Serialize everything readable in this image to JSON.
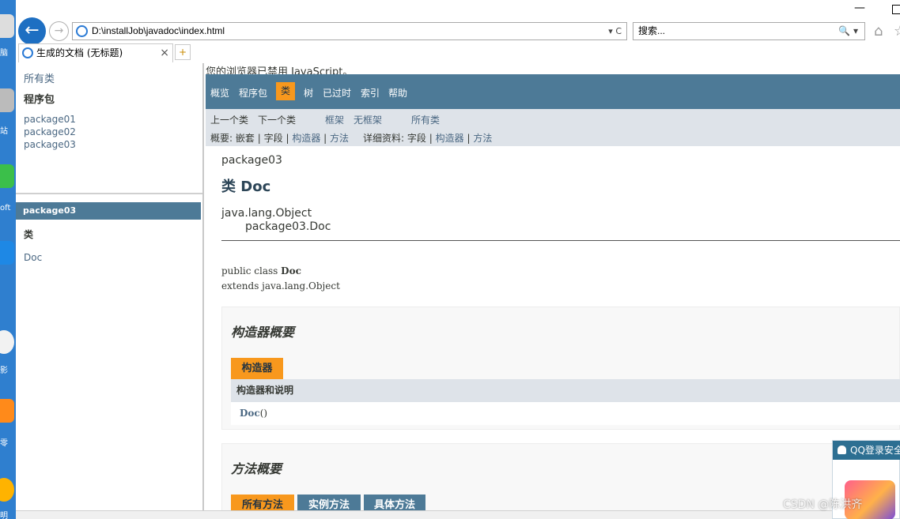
{
  "desktop": {
    "labels": [
      "脑",
      "站",
      "oft",
      "影",
      "零",
      "明"
    ]
  },
  "browser": {
    "address": "D:\\installJob\\javadoc\\index.html",
    "address_tools": "▾ C",
    "search_placeholder": "搜索...",
    "search_tools": "🔍 ▾",
    "tab_title": "生成的文档 (无标题)",
    "tab_close": "×",
    "back_glyph": "←",
    "forward_glyph": "→",
    "min_glyph": "—",
    "home_glyph": "⌂",
    "star_glyph": "☆",
    "newtab_glyph": "+"
  },
  "left_frame": {
    "all_classes": "所有类",
    "packages_heading": "程序包",
    "packages": [
      "package01",
      "package02",
      "package03"
    ],
    "current_package": "package03",
    "classes_heading": "类",
    "classes": [
      "Doc"
    ]
  },
  "main": {
    "noscript": "您的浏览器已禁用 JavaScript。",
    "nav": {
      "overview": "概览",
      "package": "程序包",
      "class": "类",
      "tree": "树",
      "deprecated": "已过时",
      "index": "索引",
      "help": "帮助"
    },
    "subnav": {
      "prev_class": "上一个类",
      "next_class": "下一个类",
      "frames": "框架",
      "no_frames": "无框架",
      "all_classes": "所有类",
      "summary_label": "概要:",
      "summary_nested": "嵌套",
      "summary_field": "字段",
      "summary_constructor": "构造器",
      "summary_method": "方法",
      "detail_label": "详细资料:",
      "detail_field": "字段",
      "detail_constructor": "构造器",
      "detail_method": "方法",
      "sep": "|"
    },
    "package_name": "package03",
    "class_title": "类 Doc",
    "inheritance": [
      "java.lang.Object",
      "package03.Doc"
    ],
    "declaration_prefix": "public class ",
    "declaration_name": "Doc",
    "declaration_extends": "extends java.lang.Object",
    "constructor_summary": {
      "title": "构造器概要",
      "caption": "构造器",
      "column_header": "构造器和说明",
      "rows": [
        {
          "name": "Doc",
          "params": "()"
        }
      ]
    },
    "method_summary": {
      "title": "方法概要",
      "captions": [
        "所有方法",
        "实例方法",
        "具体方法"
      ]
    }
  },
  "qq_popup": {
    "title": "QQ登录安全"
  },
  "watermark": "CSDN @陈洪齐",
  "colors": {
    "navbar": "#4d7a97",
    "active_tab": "#f8981d",
    "subnav": "#dee3e9",
    "link": "#4a6782"
  }
}
